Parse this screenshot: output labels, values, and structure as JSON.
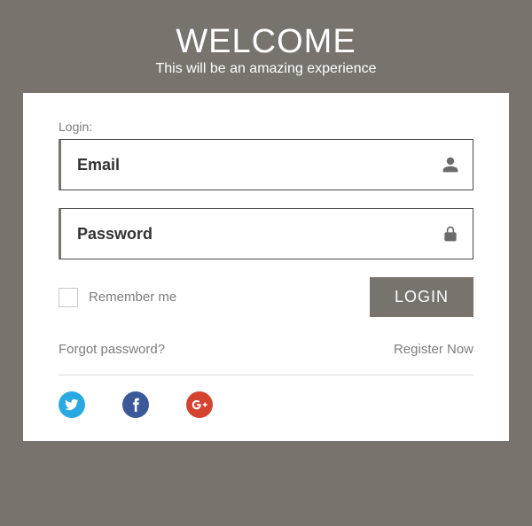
{
  "header": {
    "title": "WELCOME",
    "subtitle": "This will be an amazing experience"
  },
  "form": {
    "login_label": "Login:",
    "email_placeholder": "Email",
    "password_placeholder": "Password",
    "remember_label": "Remember me",
    "login_button": "LOGIN",
    "forgot_link": "Forgot password?",
    "register_link": "Register Now"
  },
  "social": {
    "twitter": "twitter",
    "facebook": "facebook",
    "googleplus": "google-plus"
  },
  "colors": {
    "accent": "#79736d",
    "twitter": "#29a9e1",
    "facebook": "#3b5998",
    "gplus": "#d44332"
  }
}
